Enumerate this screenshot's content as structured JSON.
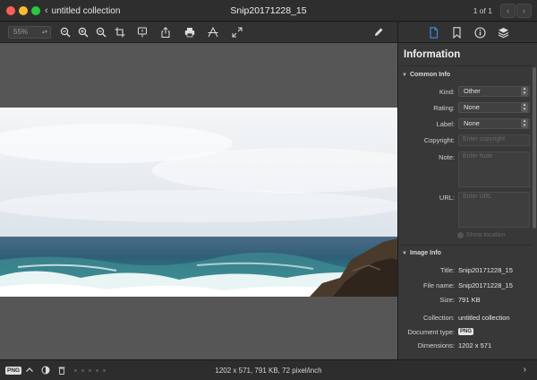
{
  "window": {
    "back_label": "untitled collection",
    "title": "Snip20171228_15",
    "pager": "1 of 1",
    "prev_icon": "chevron-left-icon",
    "next_icon": "chevron-right-icon"
  },
  "toolbar": {
    "zoom_value": "55%",
    "buttons": [
      "zoom-fit-icon",
      "zoom-in-icon",
      "zoom-out-icon",
      "crop-icon",
      "annotate-icon",
      "share-icon",
      "print-icon",
      "adjust-icon",
      "fullscreen-icon",
      "edit-pencil-icon"
    ]
  },
  "panel": {
    "tabs": [
      "info-document-icon",
      "bookmark-icon",
      "info-circle-icon",
      "layers-icon"
    ],
    "title": "Information",
    "common_info": {
      "header": "Common Info",
      "kind_label": "Kind:",
      "kind_value": "Other",
      "rating_label": "Rating:",
      "rating_value": "None",
      "label_label": "Label:",
      "label_value": "None",
      "copyright_label": "Copyright:",
      "copyright_placeholder": "Enter copyright",
      "note_label": "Note:",
      "note_placeholder": "Enter Note",
      "url_label": "URL:",
      "url_placeholder": "Enter URL",
      "map_text": "Show location"
    },
    "image_info": {
      "header": "Image Info",
      "title_label": "Title:",
      "title_value": "Snip20171228_15",
      "filename_label": "File name:",
      "filename_value": "Snip20171228_15",
      "size_label": "Size:",
      "size_value": "791 KB",
      "collection_label": "Collection:",
      "collection_value": "untitled collection",
      "doctype_label": "Document type:",
      "doctype_value": "PNG",
      "dimensions_label": "Dimensions:",
      "dimensions_value": "1202 x 571"
    }
  },
  "statusbar": {
    "format_badge": "PNG",
    "info": "1202 x 571, 791 KB, 72 pixel/inch"
  },
  "colors": {
    "accent_blue": "#3d8ef0",
    "panel_bg": "#383838",
    "canvas_bg": "#565656"
  }
}
